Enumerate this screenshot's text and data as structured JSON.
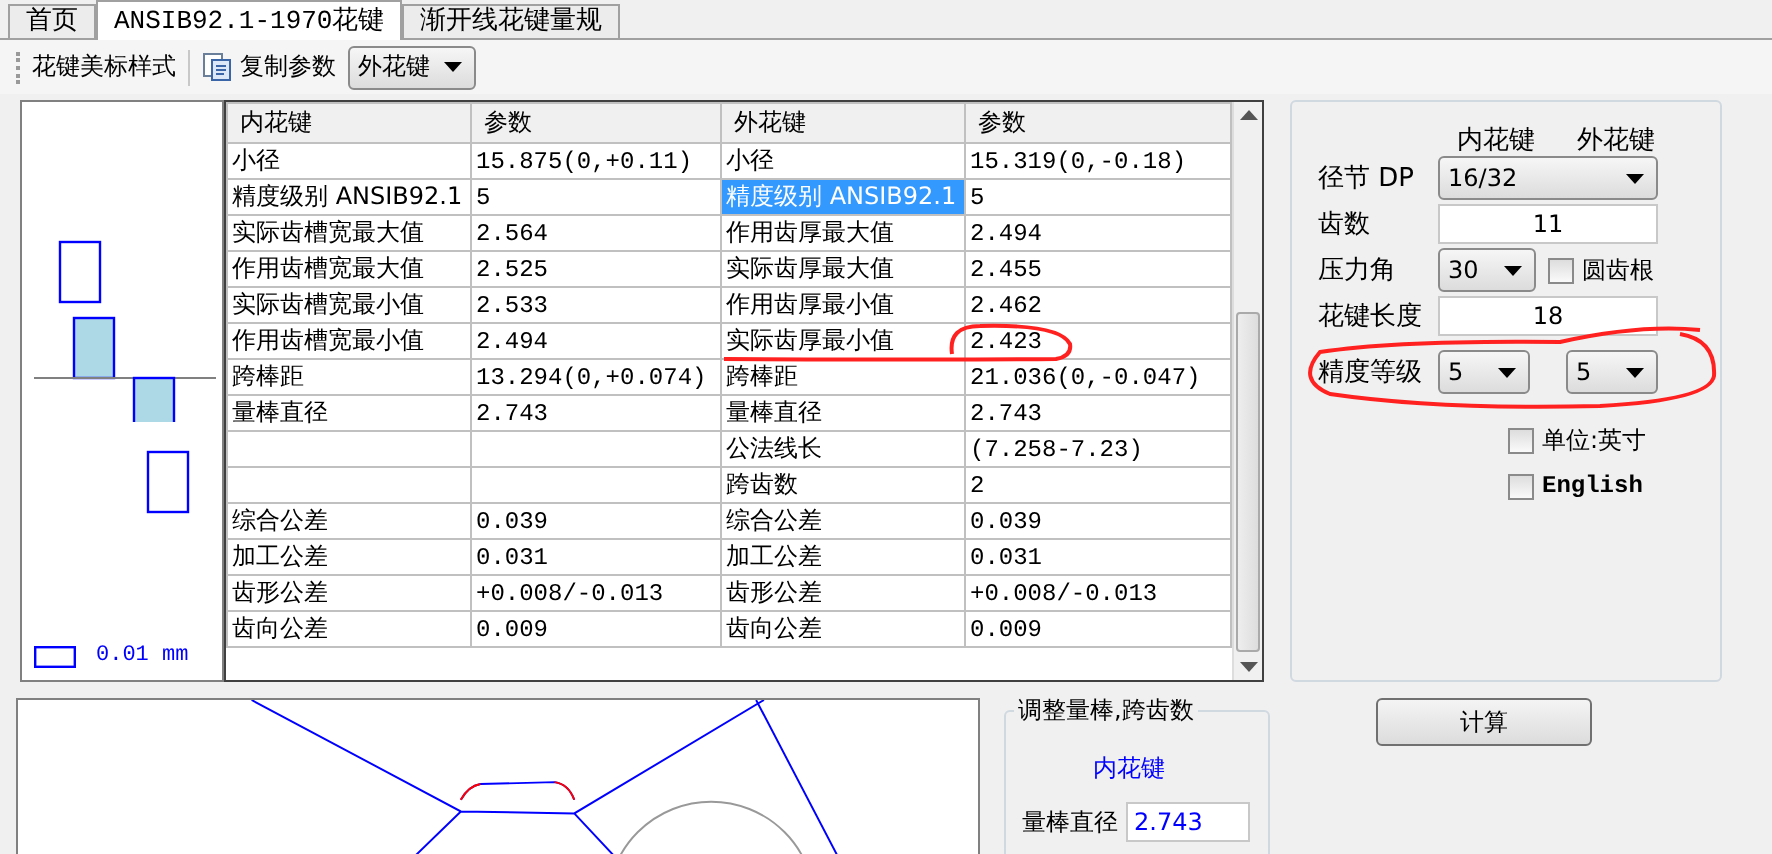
{
  "tabs": [
    {
      "label": "首页",
      "selected": false
    },
    {
      "label": "ANSIB92.1-1970花键",
      "selected": true
    },
    {
      "label": "渐开线花键量规",
      "selected": false
    }
  ],
  "toolbar": {
    "label": "花键美标样式",
    "copy_button": "复制参数",
    "spline_select": "外花键"
  },
  "legend": {
    "scale": "0.01 mm"
  },
  "table": {
    "columns": [
      "内花键",
      "参数",
      "外花键",
      "参数"
    ],
    "rows": [
      {
        "inner_name": "小径",
        "inner_value": "15.875(0,+0.11)",
        "outer_name": "小径",
        "outer_value": "15.319(0,-0.18)",
        "highlighted": false
      },
      {
        "inner_name": "精度级别 ANSIB92.1",
        "inner_value": "5",
        "outer_name": "精度级别 ANSIB92.1",
        "outer_value": "5",
        "highlighted": true
      },
      {
        "inner_name": "实际齿槽宽最大值",
        "inner_value": "2.564",
        "outer_name": "作用齿厚最大值",
        "outer_value": "2.494",
        "highlighted": false
      },
      {
        "inner_name": "作用齿槽宽最大值",
        "inner_value": "2.525",
        "outer_name": "实际齿厚最大值",
        "outer_value": "2.455",
        "highlighted": false
      },
      {
        "inner_name": "实际齿槽宽最小值",
        "inner_value": "2.533",
        "outer_name": "作用齿厚最小值",
        "outer_value": "2.462",
        "highlighted": false
      },
      {
        "inner_name": "作用齿槽宽最小值",
        "inner_value": "2.494",
        "outer_name": "实际齿厚最小值",
        "outer_value": "2.423",
        "highlighted": false
      },
      {
        "inner_name": "跨棒距",
        "inner_value": "13.294(0,+0.074)",
        "outer_name": "跨棒距",
        "outer_value": "21.036(0,-0.047)",
        "highlighted": false
      },
      {
        "inner_name": "量棒直径",
        "inner_value": "2.743",
        "outer_name": "量棒直径",
        "outer_value": "2.743",
        "highlighted": false
      },
      {
        "outer_name": "公法线长",
        "outer_value": "(7.258-7.23)",
        "highlighted": false
      },
      {
        "outer_name": "跨齿数",
        "outer_value": "2",
        "highlighted": false
      },
      {
        "inner_name": "综合公差",
        "inner_value": "0.039",
        "outer_name": "综合公差",
        "outer_value": "0.039",
        "highlighted": false
      },
      {
        "inner_name": "加工公差",
        "inner_value": "0.031",
        "outer_name": "加工公差",
        "outer_value": "0.031",
        "highlighted": false
      },
      {
        "inner_name": "齿形公差",
        "inner_value": "+0.008/-0.013",
        "outer_name": "齿形公差",
        "outer_value": "+0.008/-0.013",
        "highlighted": false
      },
      {
        "inner_name": "齿向公差",
        "inner_value": "0.009",
        "outer_name": "齿向公差",
        "outer_value": "0.009",
        "highlighted": false
      }
    ]
  },
  "settings": {
    "col_inner": "内花键",
    "col_outer": "外花键",
    "diametral_pitch": {
      "label": "径节 DP",
      "value": "16/32"
    },
    "teeth": {
      "label": "齿数",
      "value": "11"
    },
    "pressure_angle": {
      "label": "压力角",
      "value": "30"
    },
    "round_root": {
      "label": "圆齿根",
      "checked": false
    },
    "length": {
      "label": "花键长度",
      "value": "18"
    },
    "accuracy": {
      "label": "精度等级",
      "inner": "5",
      "outer": "5"
    },
    "unit_inch": {
      "label": "单位:英寸",
      "checked": false
    },
    "english": {
      "label": "English",
      "checked": false
    }
  },
  "adjust_group": {
    "title": "调整量棒,跨齿数",
    "subtitle": "内花键",
    "pin_label": "量棒直径",
    "pin_value": "2.743"
  },
  "calc_button": "计算"
}
